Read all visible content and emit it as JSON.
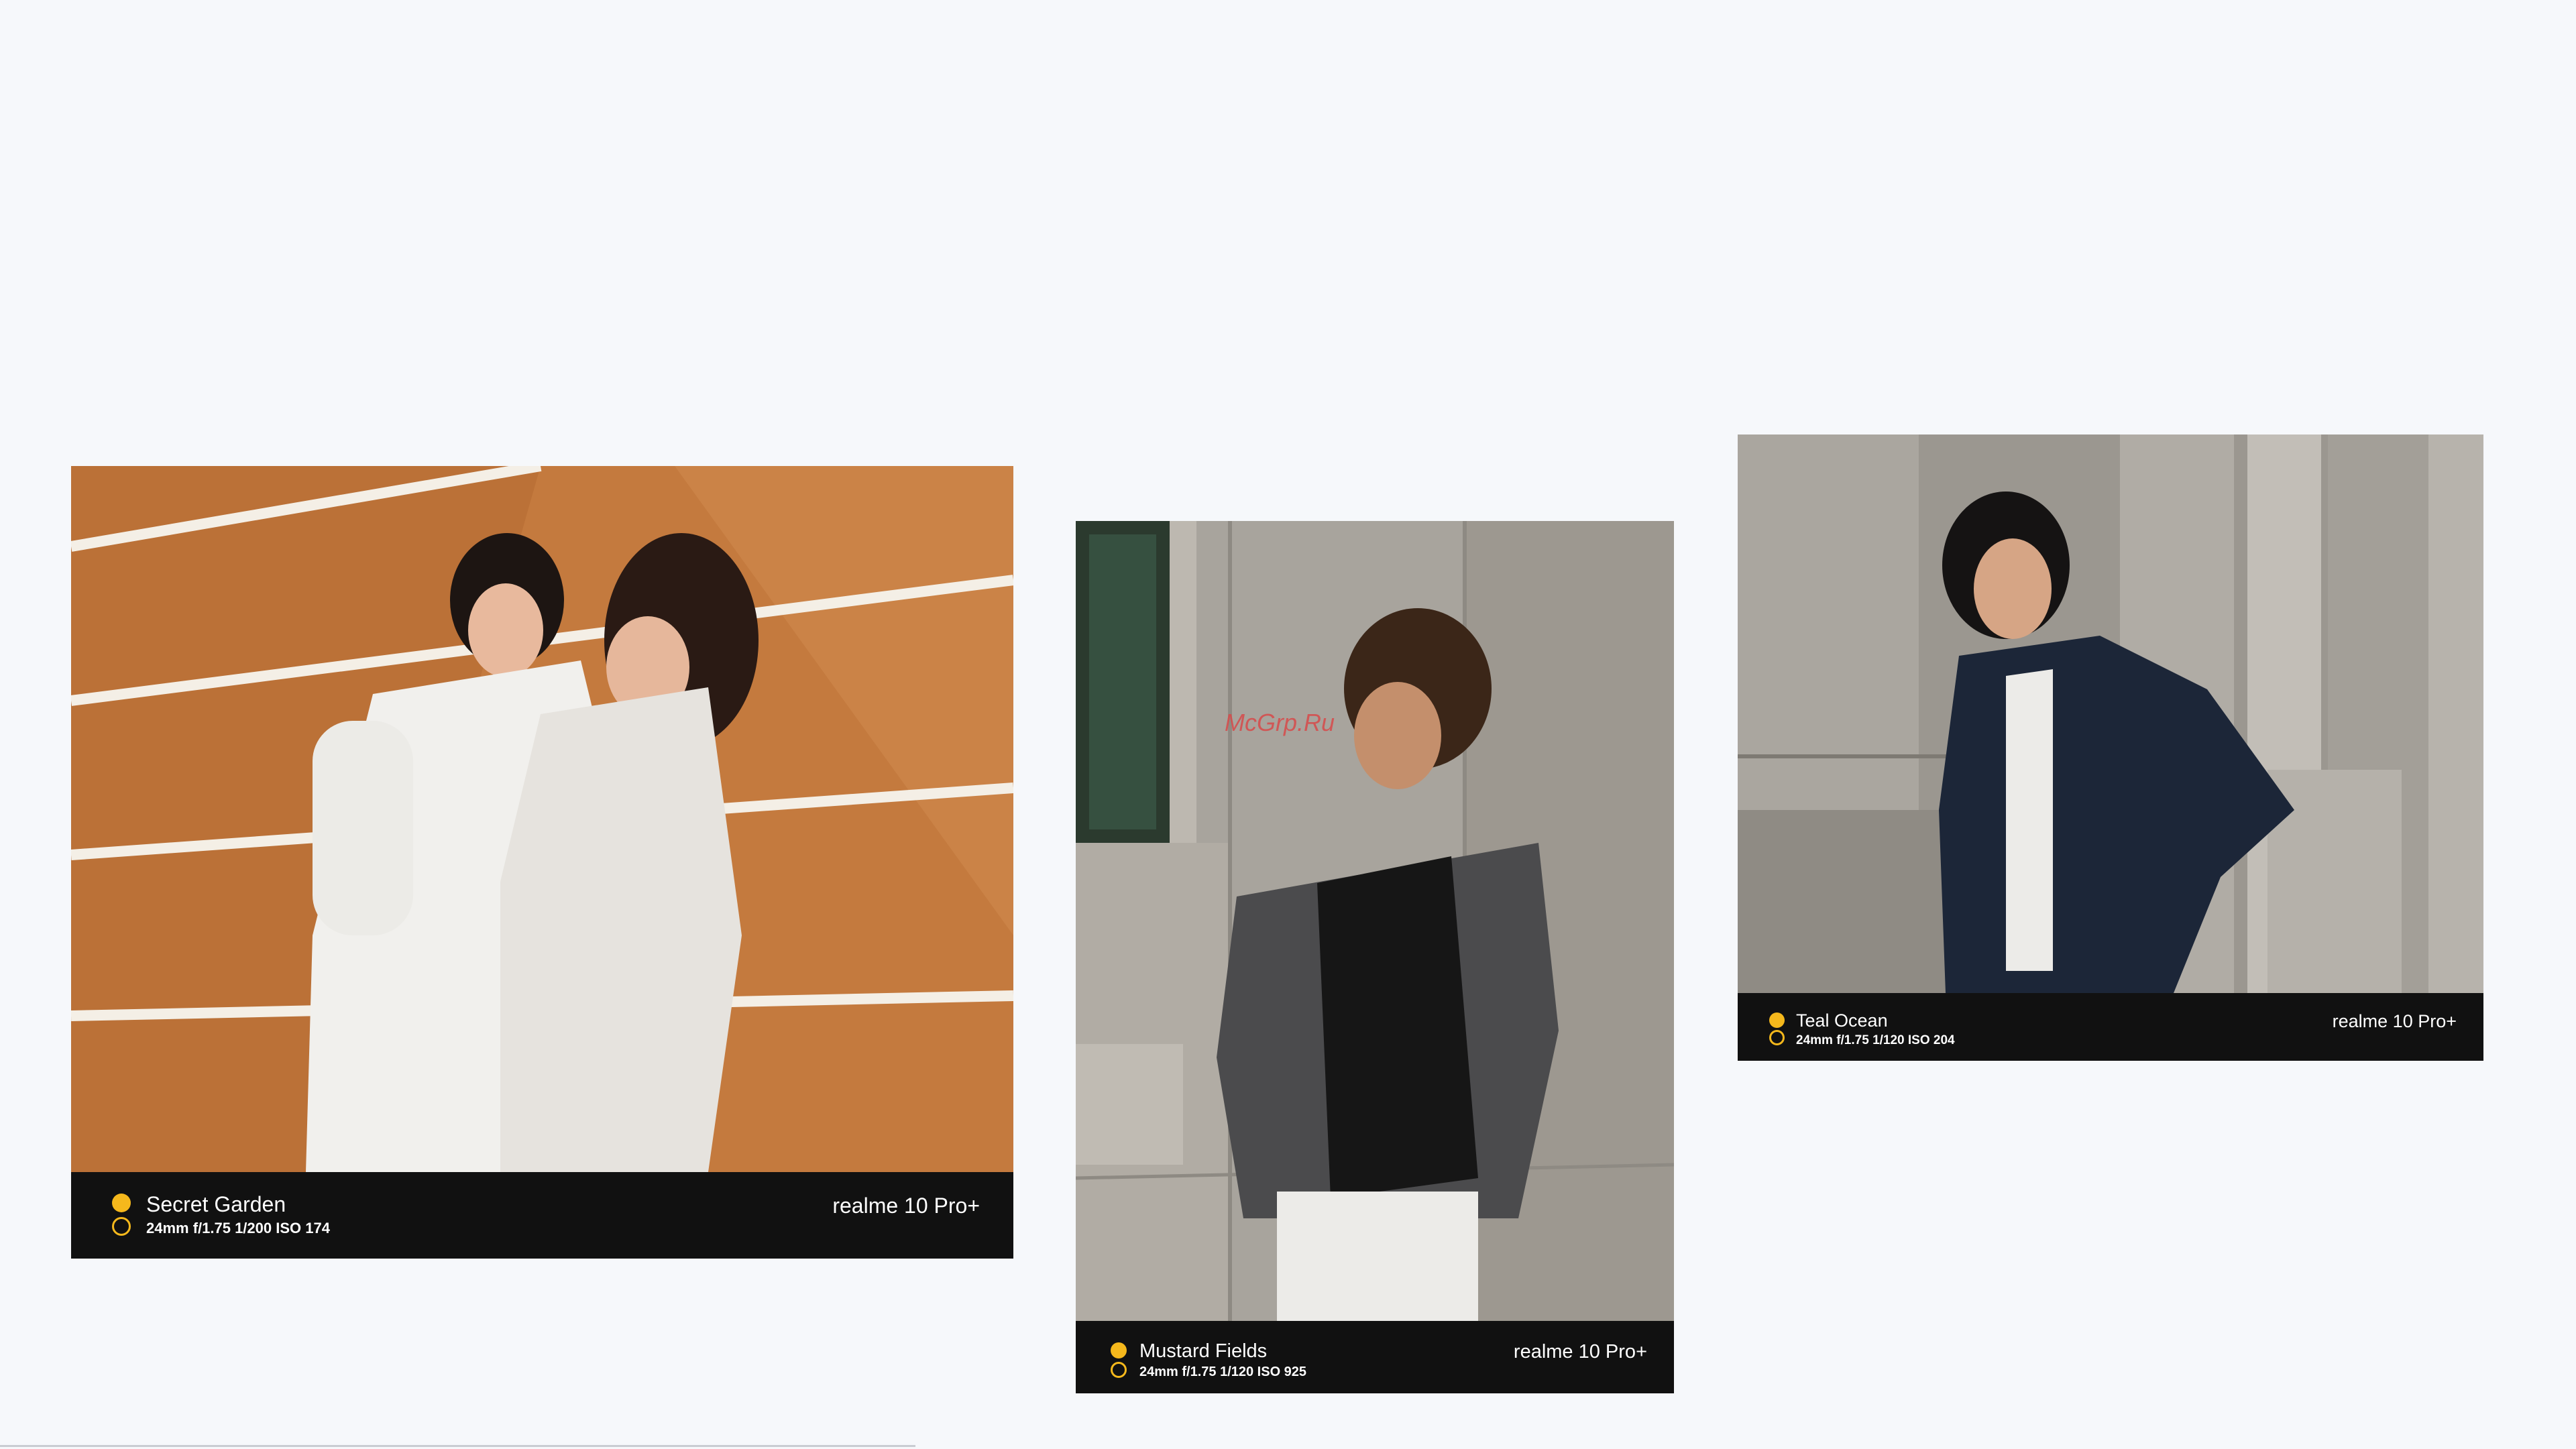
{
  "watermark": "McGrp.Ru",
  "photos": [
    {
      "filter_name": "Secret Garden",
      "exif": "24mm f/1.75 1/200 ISO 174",
      "device": "realme 10 Pro+"
    },
    {
      "filter_name": "Mustard Fields",
      "exif": "24mm f/1.75 1/120 ISO 925",
      "device": "realme 10 Pro+"
    },
    {
      "filter_name": "Teal Ocean",
      "exif": "24mm f/1.75 1/120 ISO 204",
      "device": "realme 10 Pro+"
    }
  ],
  "colors": {
    "page_background": "#f6f8fb",
    "caption_bar": "#111111",
    "accent_dot": "#f5b81c",
    "watermark": "#d84a4a"
  }
}
